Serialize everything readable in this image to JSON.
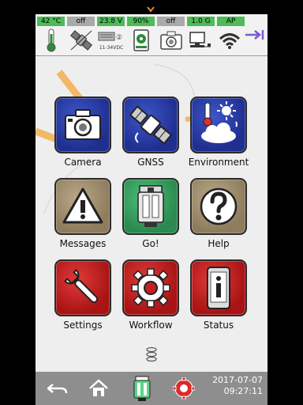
{
  "status": {
    "temperature": "42 °C",
    "gps_state": "off",
    "voltage": "23.8 V",
    "storage_percent": "90%",
    "camera_state": "off",
    "memory": "1.0 G",
    "wifi_mode": "AP",
    "power_label": "11-34VDC",
    "power_mark": "②"
  },
  "tiles": [
    {
      "label": "Camera"
    },
    {
      "label": "GNSS"
    },
    {
      "label": "Environment"
    },
    {
      "label": "Messages"
    },
    {
      "label": "Go!"
    },
    {
      "label": "Help"
    },
    {
      "label": "Settings"
    },
    {
      "label": "Workflow"
    },
    {
      "label": "Status"
    }
  ],
  "bottom": {
    "date": "2017-07-07",
    "time": "09:27:11"
  },
  "colors": {
    "status_green": "#4dbb57",
    "status_gray": "#a9a9a9",
    "tile_blue": "#2a3fae",
    "tile_tan": "#a39272",
    "tile_green": "#3aa463",
    "tile_red": "#c42020",
    "bottom_bar": "#8e8e8e"
  },
  "icons": {
    "status": [
      "thermometer-icon",
      "satellite-icon",
      "power-supply-icon",
      "storage-icon",
      "camera-icon",
      "computer-icon",
      "wifi-icon",
      "collapse-arrow-icon"
    ],
    "bottom": [
      "back-icon",
      "home-icon",
      "device-icon",
      "settings-gear-icon"
    ]
  }
}
